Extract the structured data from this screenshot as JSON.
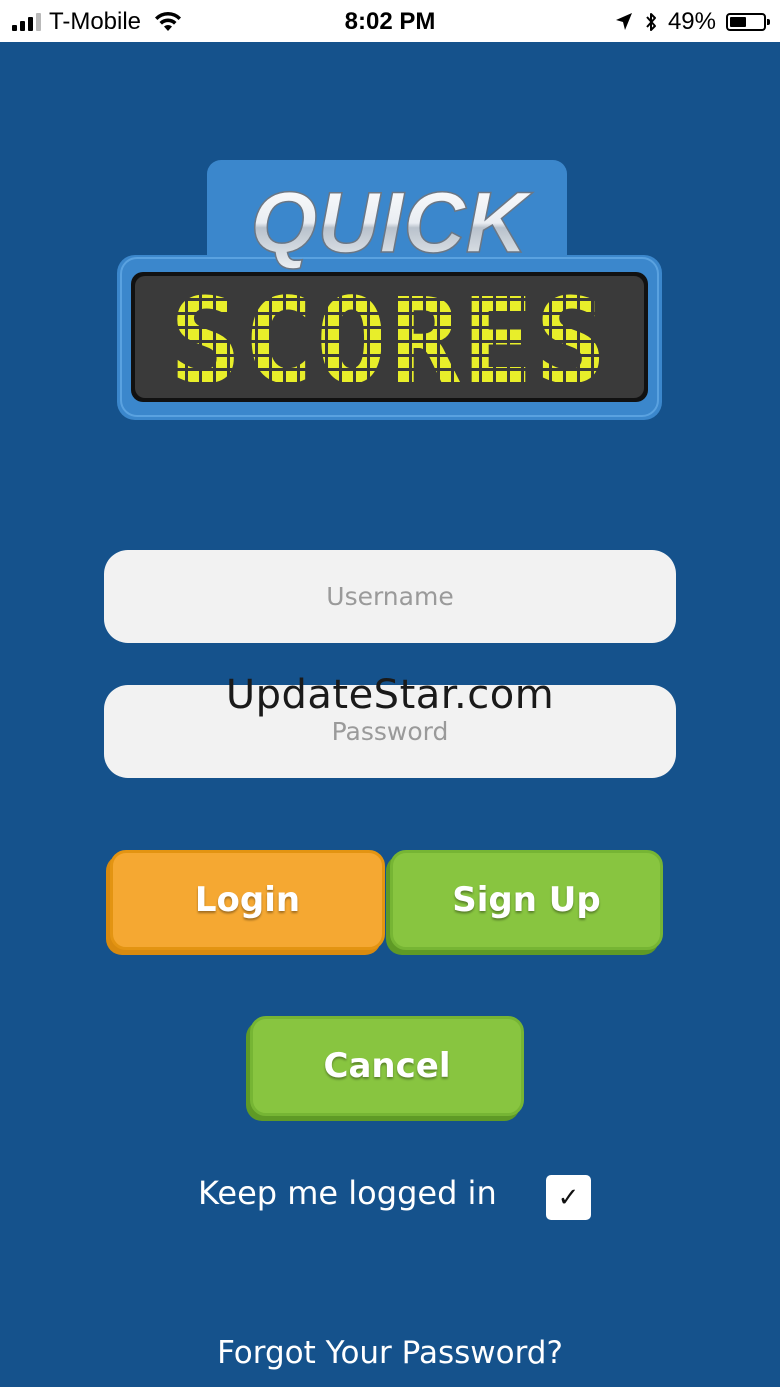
{
  "status_bar": {
    "carrier": "T-Mobile",
    "time": "8:02 PM",
    "battery": "49%",
    "battery_level": 0.49,
    "icons": [
      "signal-icon",
      "wifi-icon",
      "location-arrow-icon",
      "bluetooth-icon",
      "battery-icon"
    ]
  },
  "logo": {
    "line1": "QUICK",
    "line2": "SCORES"
  },
  "form": {
    "username_placeholder": "Username",
    "password_placeholder": "Password"
  },
  "watermark": "UpdateStar.com",
  "buttons": {
    "login": "Login",
    "signup": "Sign Up",
    "cancel": "Cancel"
  },
  "keep_logged_in": {
    "label": "Keep me logged in",
    "checked": true,
    "check_glyph": "✓"
  },
  "forgot_link": "Forgot Your Password?",
  "colors": {
    "background": "#15528c",
    "login": "#f5a832",
    "signup": "#88c540",
    "logo_blue": "#3b87cc",
    "scoreboard": "#3a3a3a",
    "led_yellow": "#e8ee2a"
  }
}
